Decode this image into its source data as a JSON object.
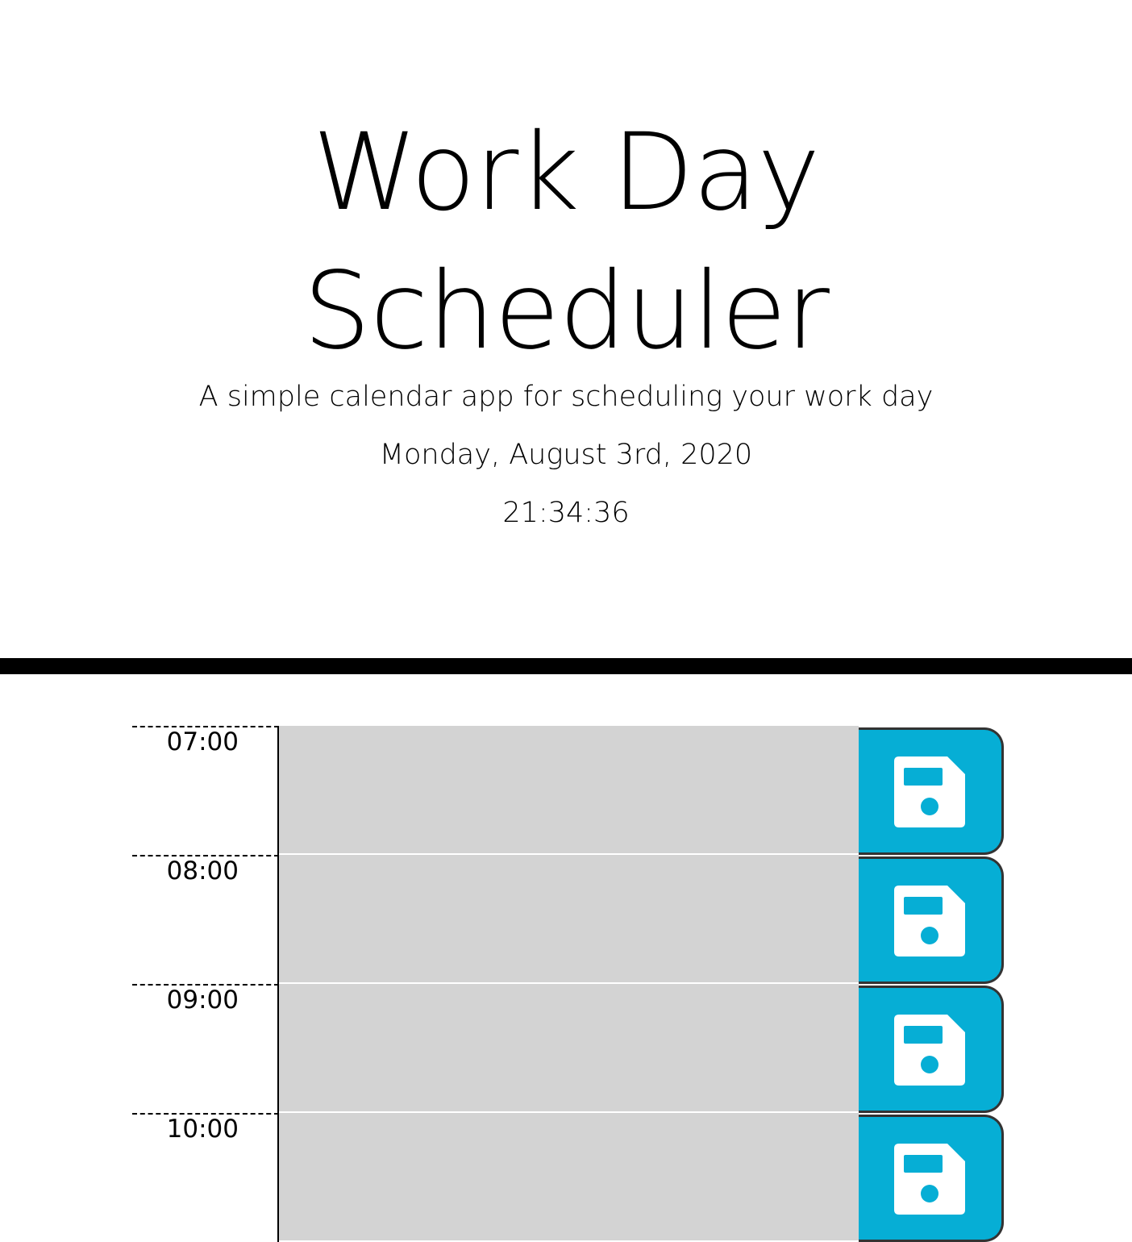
{
  "header": {
    "title_line1": "Work Day",
    "title_line2": "Scheduler",
    "subtitle": "A simple calendar app for scheduling your work day",
    "current_date": "Monday, August 3rd, 2020",
    "current_time": "21:34:36"
  },
  "colors": {
    "save_button": "#06aed5",
    "past_block": "#d3d3d3"
  },
  "time_blocks": [
    {
      "hour": "07:00",
      "task": "",
      "icon": "save-icon"
    },
    {
      "hour": "08:00",
      "task": "",
      "icon": "save-icon"
    },
    {
      "hour": "09:00",
      "task": "",
      "icon": "save-icon"
    },
    {
      "hour": "10:00",
      "task": "",
      "icon": "save-icon"
    }
  ]
}
